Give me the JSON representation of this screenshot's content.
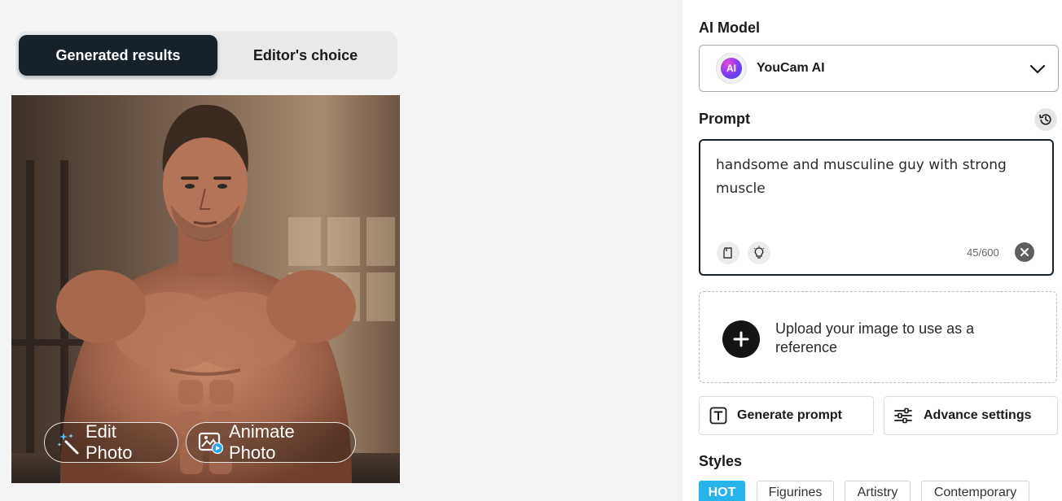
{
  "tabs": {
    "generated_label": "Generated results",
    "editors_label": "Editor's choice",
    "active": "Generated results"
  },
  "photo_actions": {
    "edit_label": "Edit Photo",
    "animate_label": "Animate Photo"
  },
  "panel": {
    "ai_model_label": "AI Model",
    "model": {
      "name": "YouCam AI",
      "logo_text": "AI",
      "icon": "youcam-ai-logo"
    },
    "prompt_label": "Prompt",
    "prompt_value": "handsome and musculine guy with strong muscle",
    "counter": "45/600",
    "upload_text": "Upload your image to use as a reference",
    "generate_prompt_label": "Generate prompt",
    "advance_settings_label": "Advance settings",
    "styles_label": "Styles",
    "styles": [
      {
        "label": "HOT",
        "selected": true
      },
      {
        "label": "Figurines",
        "selected": false
      },
      {
        "label": "Artistry",
        "selected": false
      },
      {
        "label": "Contemporary",
        "selected": false
      }
    ]
  },
  "colors": {
    "tab_active_bg": "#16212a",
    "hot_chip": "#27b4ea",
    "panel_bg": "#ffffff",
    "page_bg": "#f4f4f4"
  }
}
